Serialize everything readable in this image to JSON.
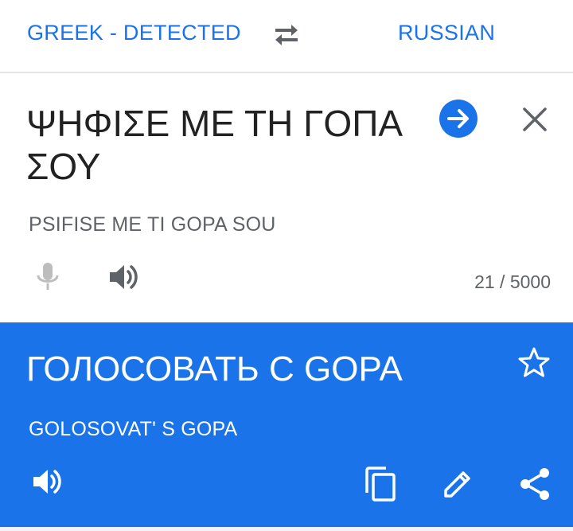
{
  "header": {
    "source_language": "GREEK - DETECTED",
    "target_language": "RUSSIAN",
    "swap_icon": "swap-arrows-icon"
  },
  "input": {
    "text": "ΨΗΦΙΣΕ ΜΕ ΤΗ ΓΟΠΑ ΣΟΥ",
    "transliteration": "PSIFISE ME TI GOPA SOU",
    "char_count": "21 / 5000",
    "icons": [
      "arrow-forward-icon",
      "close-icon",
      "mic-icon",
      "speaker-icon"
    ]
  },
  "result": {
    "translation": "ГОЛОСОВАТЬ С GOPA",
    "transliteration": "GOLOSOVAT' S GOPA",
    "icons": [
      "star-icon",
      "speaker-icon",
      "copy-icon",
      "edit-icon",
      "share-icon"
    ]
  },
  "colors": {
    "accent": "#1a73e8",
    "text_primary": "#222222",
    "text_secondary": "#5f6368"
  }
}
